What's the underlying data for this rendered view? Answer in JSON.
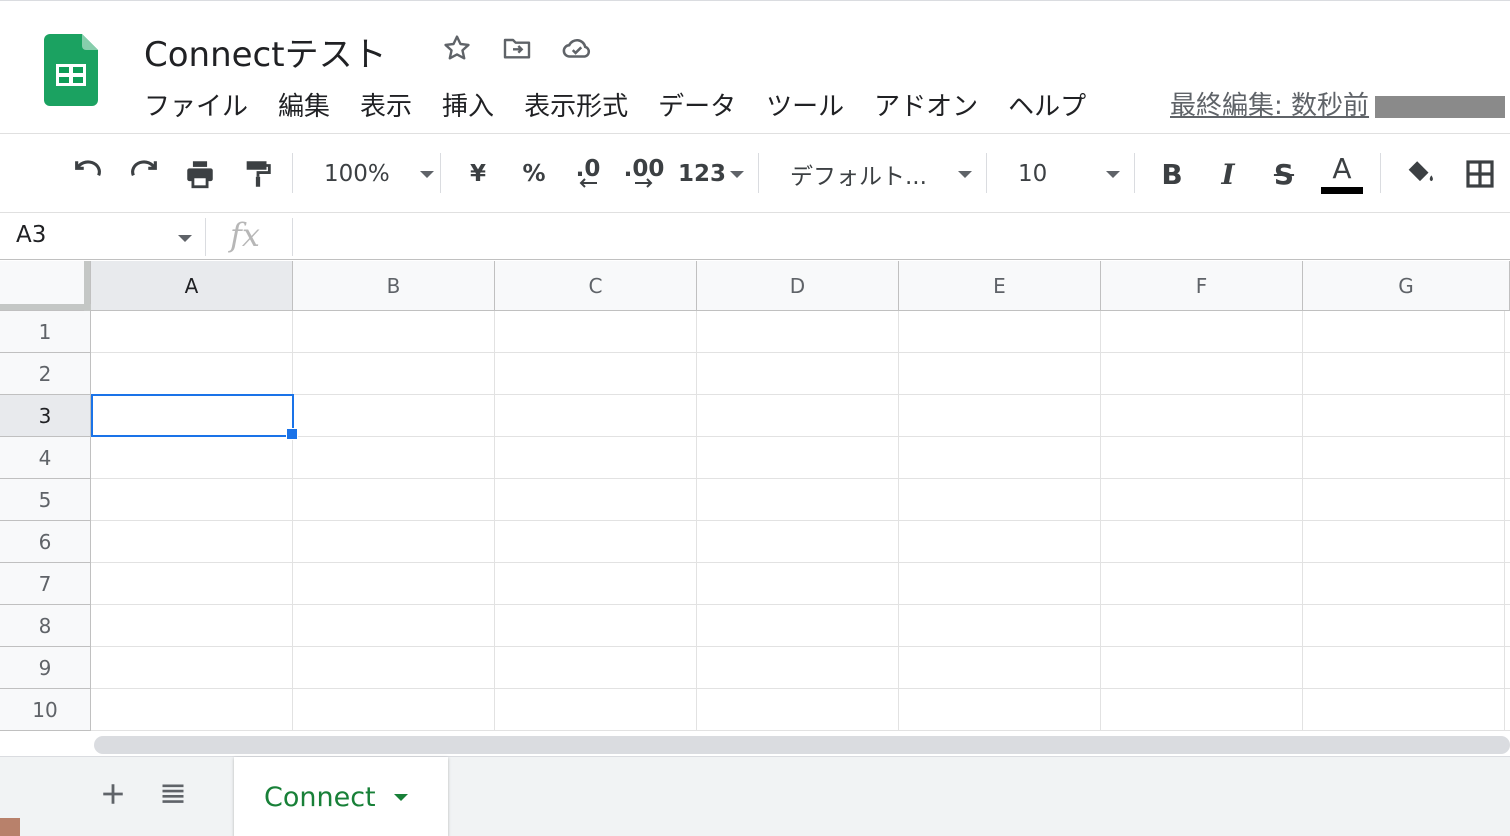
{
  "app": {
    "title": "Connectテスト",
    "brand_color": "#0f9d58"
  },
  "title_icons": [
    "star-icon",
    "move-to-folder-icon",
    "cloud-saved-icon"
  ],
  "menu": {
    "items": [
      "ファイル",
      "編集",
      "表示",
      "挿入",
      "表示形式",
      "データ",
      "ツール",
      "アドオン",
      "ヘルプ"
    ],
    "last_edit": "最終編集: 数秒前"
  },
  "toolbar": {
    "zoom": "100%",
    "currency": "¥",
    "percent": "%",
    "decrease_decimal": ".0",
    "increase_decimal": ".00",
    "more_formats": "123",
    "font": "デフォルト...",
    "font_size": "10",
    "bold": "B",
    "italic": "I",
    "strike": "S",
    "text_color_label": "A",
    "text_color": "#000000"
  },
  "formula_bar": {
    "name_box": "A3",
    "fx": "fx",
    "value": ""
  },
  "grid": {
    "columns": [
      "A",
      "B",
      "C",
      "D",
      "E",
      "F",
      "G"
    ],
    "rows": [
      "1",
      "2",
      "3",
      "4",
      "5",
      "6",
      "7",
      "8",
      "9",
      "10"
    ],
    "selected_cell": "A3",
    "selection_color": "#1a73e8"
  },
  "sheets": {
    "tabs": [
      {
        "name": "Connect",
        "active": true
      }
    ],
    "active_color": "#188038"
  }
}
